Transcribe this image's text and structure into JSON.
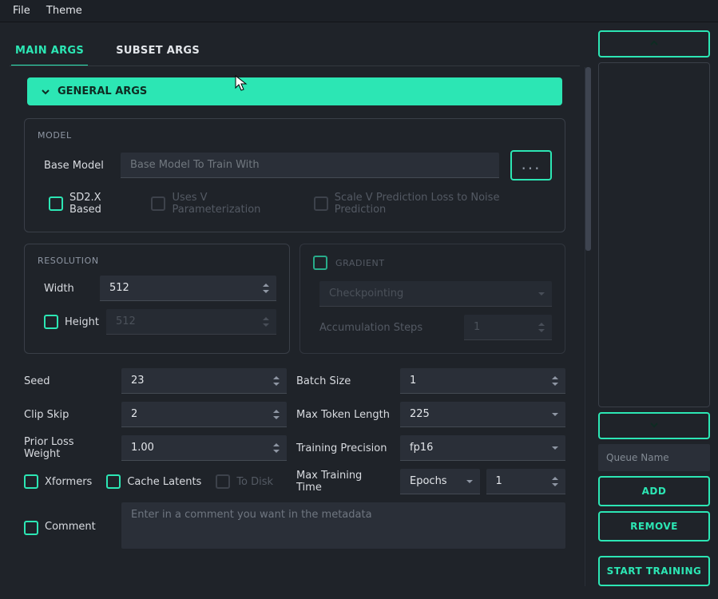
{
  "menu": {
    "file": "File",
    "theme": "Theme"
  },
  "tabs": {
    "main": "MAIN ARGS",
    "subset": "SUBSET ARGS"
  },
  "banner": "GENERAL ARGS",
  "model": {
    "legend": "MODEL",
    "base_label": "Base Model",
    "base_placeholder": "Base Model To Train With",
    "browse": "...",
    "sd2x": "SD2.X Based",
    "vparam": "Uses V Parameterization",
    "scalev": "Scale V Prediction Loss to Noise Prediction"
  },
  "resolution": {
    "legend": "RESOLUTION",
    "width_label": "Width",
    "width_value": "512",
    "height_label": "Height",
    "height_placeholder": "512"
  },
  "gradient": {
    "legend": "GRADIENT",
    "checkpointing": "Checkpointing",
    "accum_label": "Accumulation Steps",
    "accum_value": "1"
  },
  "fields": {
    "seed_label": "Seed",
    "seed_value": "23",
    "clip_label": "Clip Skip",
    "clip_value": "2",
    "prior_label": "Prior Loss Weight",
    "prior_value": "1.00",
    "batch_label": "Batch Size",
    "batch_value": "1",
    "maxtok_label": "Max Token Length",
    "maxtok_value": "225",
    "prec_label": "Training Precision",
    "prec_value": "fp16",
    "mtime_label": "Max Training Time",
    "mtime_unit": "Epochs",
    "mtime_value": "1"
  },
  "checks": {
    "xformers": "Xformers",
    "cache": "Cache Latents",
    "todisk": "To Disk",
    "comment": "Comment"
  },
  "comment_placeholder": "Enter in a comment you want in the metadata",
  "side": {
    "queue_placeholder": "Queue Name",
    "add": "ADD",
    "remove": "REMOVE",
    "start": "START TRAINING"
  }
}
